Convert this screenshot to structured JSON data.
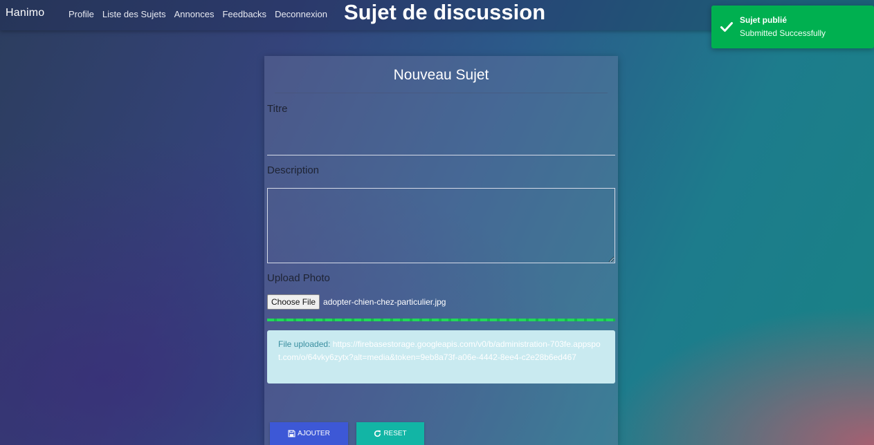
{
  "navbar": {
    "brand": "Hanimo",
    "links": [
      "Profile",
      "Liste des Sujets",
      "Annonces",
      "Feedbacks",
      "Deconnexion"
    ],
    "heading": "Sujet de discussion"
  },
  "toast": {
    "icon": "check-icon",
    "title": "Sujet publié",
    "message": "Submitted Successfully",
    "color": "#00b050"
  },
  "form": {
    "title": "Nouveau Sujet",
    "titre_label": "Titre",
    "titre_value": "",
    "description_label": "Description",
    "description_value": "",
    "upload_label": "Upload Photo",
    "choose_file_label": "Choose File",
    "file_name": "adopter-chien-chez-particulier.jpg",
    "upload_progress_percent": 100,
    "alert_prefix": "File uploaded:",
    "alert_url": "https://firebasestorage.googleapis.com/v0/b/administration-703fe.appspot.com/o/64vky6zytx?alt=media&token=9eb8a73f-a06e-4442-8ee4-c2e28b6ed467",
    "submit_label": "AJOUTER",
    "submit_icon": "save-icon",
    "reset_label": "RESET",
    "reset_icon": "refresh-icon",
    "submit_color": "#3d58d6",
    "reset_color": "#12b5a5"
  }
}
